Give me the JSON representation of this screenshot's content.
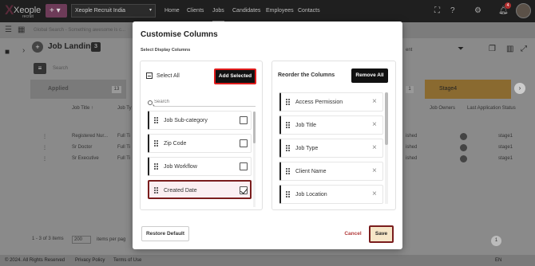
{
  "topbar": {
    "logo_text": "Xeople",
    "logo_sub": "recruit",
    "plus": "+ ▾",
    "org": "Xeople Recruit India",
    "nav": [
      "Home",
      "Clients",
      "Jobs",
      "Candidates",
      "Employees",
      "Contacts"
    ],
    "notification_count": "4"
  },
  "subbar": {
    "search_placeholder": "Global Search - Something awesome is c..."
  },
  "landing": {
    "title": "Job Landing",
    "count": "3",
    "entity": "ent",
    "search_placeholder": "Search"
  },
  "stages": {
    "applied": "Applied",
    "applied_count": "13",
    "stage4": "Stage4",
    "stage_count": "1"
  },
  "table": {
    "headers": [
      "Job Title ↑",
      "Job Ty",
      "Job Owners",
      "Last Application Status"
    ],
    "rows": [
      {
        "title": "Registered Nur...",
        "type": "Full Ti",
        "status_left": "ished",
        "owner": "",
        "stage": "stage1"
      },
      {
        "title": "Sr Doctor",
        "type": "Full Ti",
        "status_left": "ished",
        "owner": "",
        "stage": "stage1"
      },
      {
        "title": "Sr Executive",
        "type": "Full Ti",
        "status_left": "ished",
        "owner": "",
        "stage": "stage1"
      }
    ]
  },
  "pager": {
    "range": "1 - 3 of 3 items",
    "per_page": "200",
    "per_page_label": "items per pag",
    "page": "1"
  },
  "footer": {
    "copyright": "© 2024. All Rights Reserved",
    "privacy": "Privacy Policy",
    "terms": "Terms of Use",
    "lang": "EN"
  },
  "modal": {
    "title": "Customise Columns",
    "subtitle": "Select Display Columns",
    "select_all": "Select All",
    "add_selected": "Add Selected",
    "search_placeholder": "Search",
    "available": [
      {
        "label": "Job Sub-category",
        "checked": false
      },
      {
        "label": "Zip Code",
        "checked": false
      },
      {
        "label": "Job Workflow",
        "checked": false
      },
      {
        "label": "Created Date",
        "checked": true
      }
    ],
    "reorder_title": "Reorder the Columns",
    "remove_all": "Remove All",
    "ordered": [
      {
        "label": "Access Permission"
      },
      {
        "label": "Job Title"
      },
      {
        "label": "Job Type"
      },
      {
        "label": "Client Name"
      },
      {
        "label": "Job Location"
      }
    ],
    "restore_default": "Restore Default",
    "cancel": "Cancel",
    "save": "Save"
  }
}
